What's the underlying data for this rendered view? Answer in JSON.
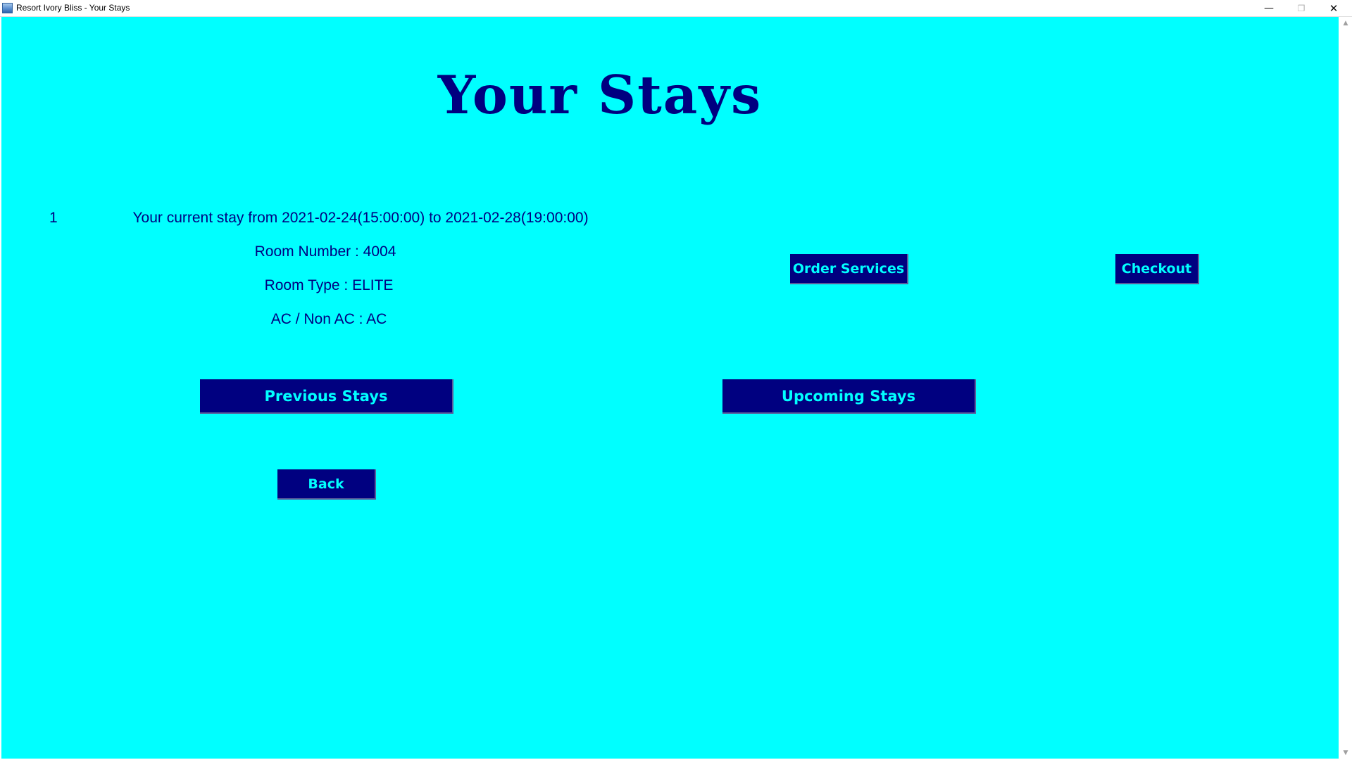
{
  "window": {
    "title": "Resort Ivory Bliss - Your Stays",
    "minimize_icon": "minimize-icon",
    "maximize_icon": "restore-icon",
    "close_icon": "close-icon"
  },
  "page": {
    "title": "Your Stays",
    "background_color": "#00ffff",
    "text_color": "#000080"
  },
  "current_stay": {
    "index": "1",
    "period": "Your current stay from 2021-02-24(15:00:00) to 2021-02-28(19:00:00)",
    "room_number": "Room Number : 4004",
    "room_type": "Room Type : ELITE",
    "ac_type": "AC / Non AC : AC"
  },
  "actions": {
    "order_services": "Order Services",
    "checkout": "Checkout",
    "previous_stays": "Previous Stays",
    "upcoming_stays": "Upcoming Stays",
    "back": "Back"
  }
}
